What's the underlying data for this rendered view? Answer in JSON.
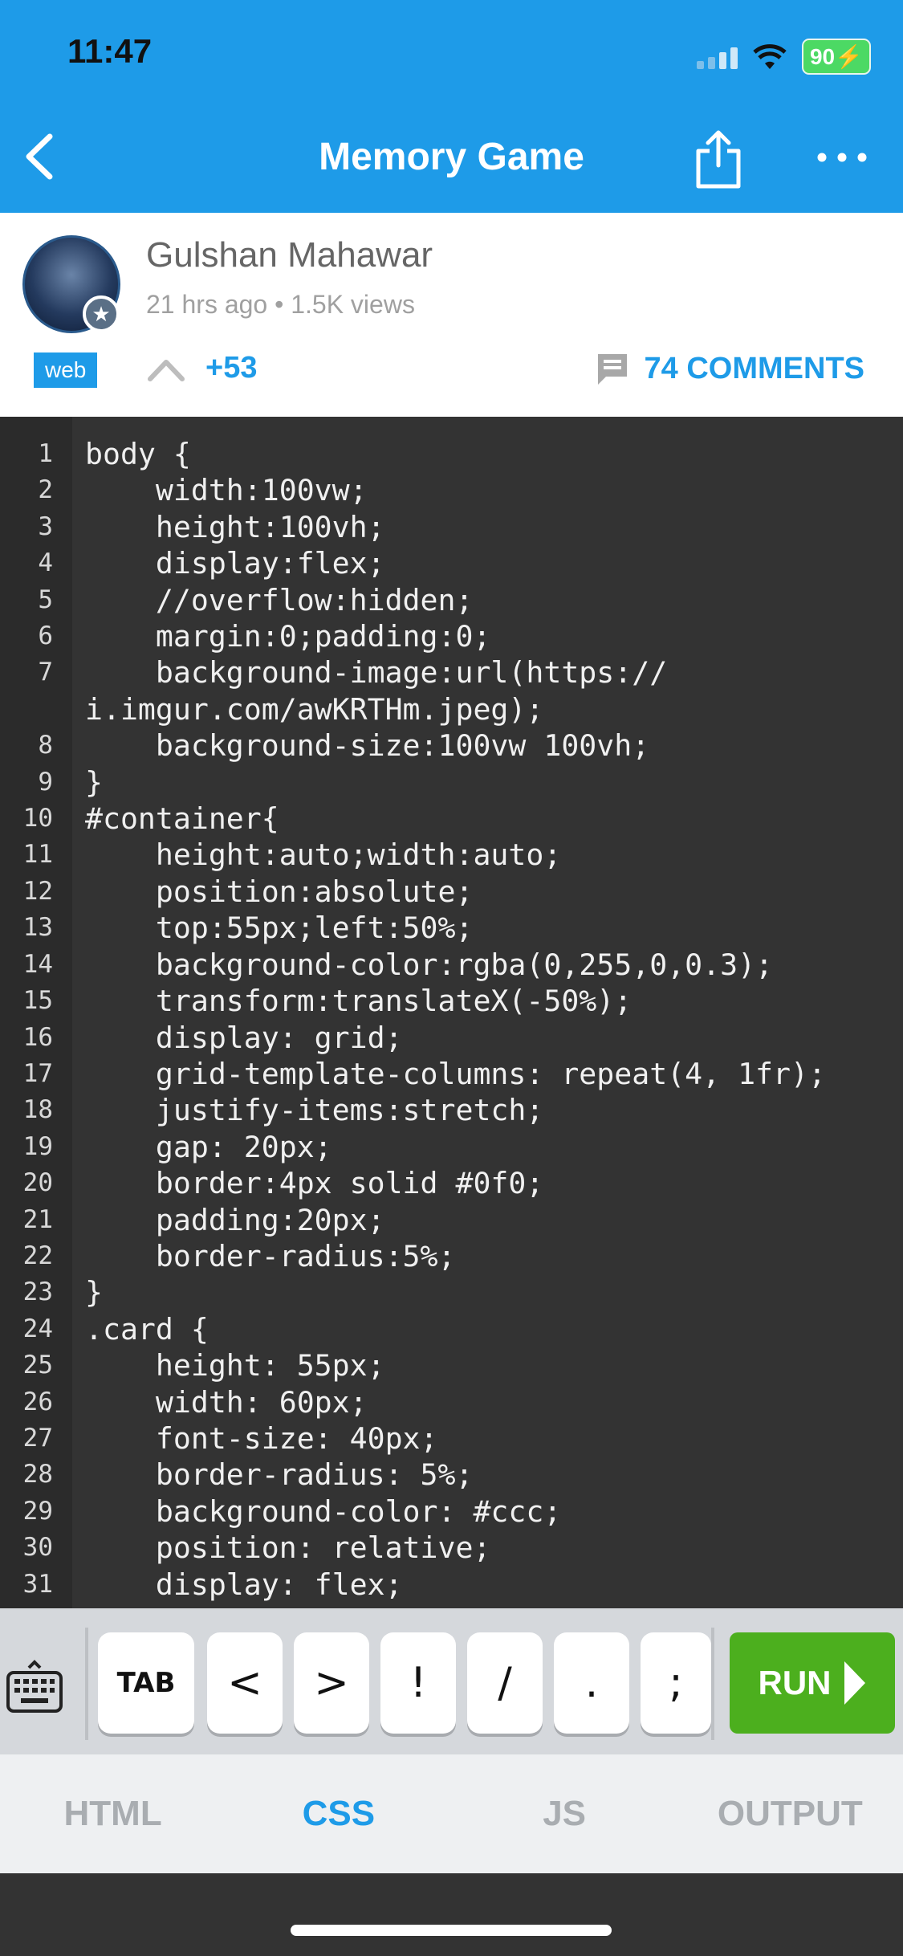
{
  "status_bar": {
    "time": "11:47",
    "battery": "90"
  },
  "header": {
    "title": "Memory Game"
  },
  "post": {
    "author": "Gulshan Mahawar",
    "meta": "21 hrs ago • 1.5K views",
    "tag": "web",
    "votes": "+53",
    "comments": "74 COMMENTS"
  },
  "code": {
    "lines": [
      {
        "n": "1",
        "t": "body {"
      },
      {
        "n": "2",
        "t": "    width:100vw;"
      },
      {
        "n": "3",
        "t": "    height:100vh;"
      },
      {
        "n": "4",
        "t": "    display:flex;"
      },
      {
        "n": "5",
        "t": "    //overflow:hidden;"
      },
      {
        "n": "6",
        "t": "    margin:0;padding:0;"
      },
      {
        "n": "7",
        "t": "    background-image:url(https://"
      },
      {
        "n": "",
        "t": "i.imgur.com/awKRTHm.jpeg);"
      },
      {
        "n": "8",
        "t": "    background-size:100vw 100vh;"
      },
      {
        "n": "9",
        "t": "}"
      },
      {
        "n": "10",
        "t": "#container{"
      },
      {
        "n": "11",
        "t": "    height:auto;width:auto;"
      },
      {
        "n": "12",
        "t": "    position:absolute;"
      },
      {
        "n": "13",
        "t": "    top:55px;left:50%;"
      },
      {
        "n": "14",
        "t": "    background-color:rgba(0,255,0,0.3);"
      },
      {
        "n": "15",
        "t": "    transform:translateX(-50%);"
      },
      {
        "n": "16",
        "t": "    display: grid;"
      },
      {
        "n": "17",
        "t": "    grid-template-columns: repeat(4, 1fr);"
      },
      {
        "n": "18",
        "t": "    justify-items:stretch;"
      },
      {
        "n": "19",
        "t": "    gap: 20px;"
      },
      {
        "n": "20",
        "t": "    border:4px solid #0f0;"
      },
      {
        "n": "21",
        "t": "    padding:20px;"
      },
      {
        "n": "22",
        "t": "    border-radius:5%;"
      },
      {
        "n": "23",
        "t": "}"
      },
      {
        "n": "24",
        "t": ".card {"
      },
      {
        "n": "25",
        "t": "    height: 55px;"
      },
      {
        "n": "26",
        "t": "    width: 60px;"
      },
      {
        "n": "27",
        "t": "    font-size: 40px;"
      },
      {
        "n": "28",
        "t": "    border-radius: 5%;"
      },
      {
        "n": "29",
        "t": "    background-color: #ccc;"
      },
      {
        "n": "30",
        "t": "    position: relative;"
      },
      {
        "n": "31",
        "t": "    display: flex;"
      }
    ]
  },
  "keybar": {
    "keys": [
      "TAB",
      "<",
      ">",
      "!",
      "/",
      ".",
      ";"
    ],
    "run_label": "RUN"
  },
  "tabs": [
    {
      "label": "HTML",
      "active": false
    },
    {
      "label": "CSS",
      "active": true
    },
    {
      "label": "JS",
      "active": false
    },
    {
      "label": "OUTPUT",
      "active": false
    }
  ],
  "colors": {
    "accent": "#1e9be8",
    "run": "#4caf1e",
    "editor_bg": "#333333"
  }
}
